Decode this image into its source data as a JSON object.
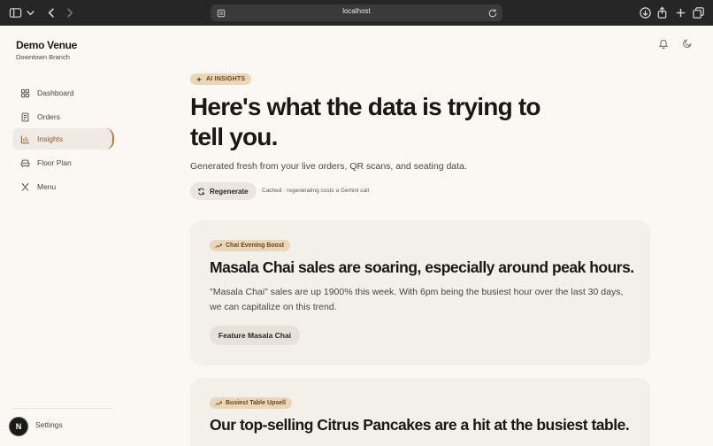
{
  "browser": {
    "url": "localhost"
  },
  "sidebar": {
    "venue_name": "Demo Venue",
    "branch": "Downtown Branch",
    "items": [
      {
        "label": "Dashboard",
        "icon": "grid-icon"
      },
      {
        "label": "Orders",
        "icon": "receipt-icon"
      },
      {
        "label": "Insights",
        "icon": "bar-chart-icon",
        "active": true
      },
      {
        "label": "Floor Plan",
        "icon": "armchair-icon"
      },
      {
        "label": "Menu",
        "icon": "utensils-icon"
      }
    ],
    "settings_label": "Settings",
    "avatar_initial": "N"
  },
  "header": {
    "bell_icon": "bell-icon",
    "theme_icon": "moon-icon"
  },
  "hero": {
    "badge": "AI INSIGHTS",
    "title": "Here's what the data is trying to tell you.",
    "subtitle": "Generated fresh from your live orders, QR scans, and seating data.",
    "regenerate_label": "Regenerate",
    "cached_note": "Cached · regenerating costs a Gemini call"
  },
  "insights": [
    {
      "tag": "Chai Evening Boost",
      "title": "Masala Chai sales are soaring, especially around peak hours.",
      "body": "\"Masala Chai\" sales are up 1900% this week. With 6pm being the busiest hour over the last 30 days, we can capitalize on this trend.",
      "action_label": "Feature Masala Chai"
    },
    {
      "tag": "Busiest Table Upsell",
      "title": "Our top-selling Citrus Pancakes are a hit at the busiest table."
    }
  ],
  "colors": {
    "accent": "#b07a3c",
    "pill_bg": "#ead6b9",
    "pill_text": "#6d4419",
    "page_bg": "#fbf8f4",
    "card_bg": "#f3efe9"
  }
}
